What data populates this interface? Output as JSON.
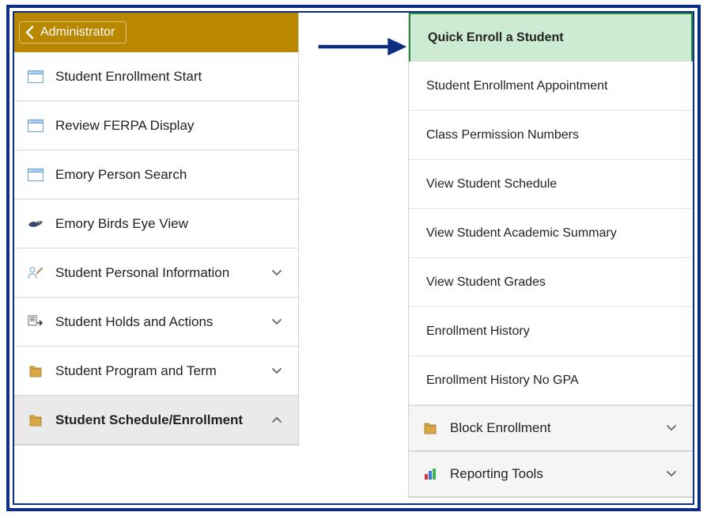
{
  "header": {
    "back_label": "Administrator"
  },
  "left_menu": {
    "items": [
      {
        "label": "Student Enrollment Start",
        "icon": "window",
        "expandable": false
      },
      {
        "label": "Review FERPA Display",
        "icon": "window",
        "expandable": false
      },
      {
        "label": "Emory Person Search",
        "icon": "window",
        "expandable": false
      },
      {
        "label": "Emory Birds Eye View",
        "icon": "bird",
        "expandable": false
      },
      {
        "label": "Student Personal Information",
        "icon": "person",
        "expandable": true
      },
      {
        "label": "Student Holds and Actions",
        "icon": "transfer",
        "expandable": true
      },
      {
        "label": "Student Program and Term",
        "icon": "folder",
        "expandable": true
      },
      {
        "label": "Student Schedule/Enrollment",
        "icon": "folder",
        "expandable": true,
        "active": true
      }
    ]
  },
  "right_menu": {
    "highlight": "Quick Enroll a Student",
    "items": [
      "Student Enrollment Appointment",
      "Class Permission Numbers",
      "View Student Schedule",
      "View Student Academic Summary",
      "View Student Grades",
      "Enrollment History",
      "Enrollment History No GPA"
    ],
    "folders": [
      {
        "label": "Block Enrollment",
        "icon": "folder"
      },
      {
        "label": "Reporting Tools",
        "icon": "chart"
      }
    ]
  }
}
